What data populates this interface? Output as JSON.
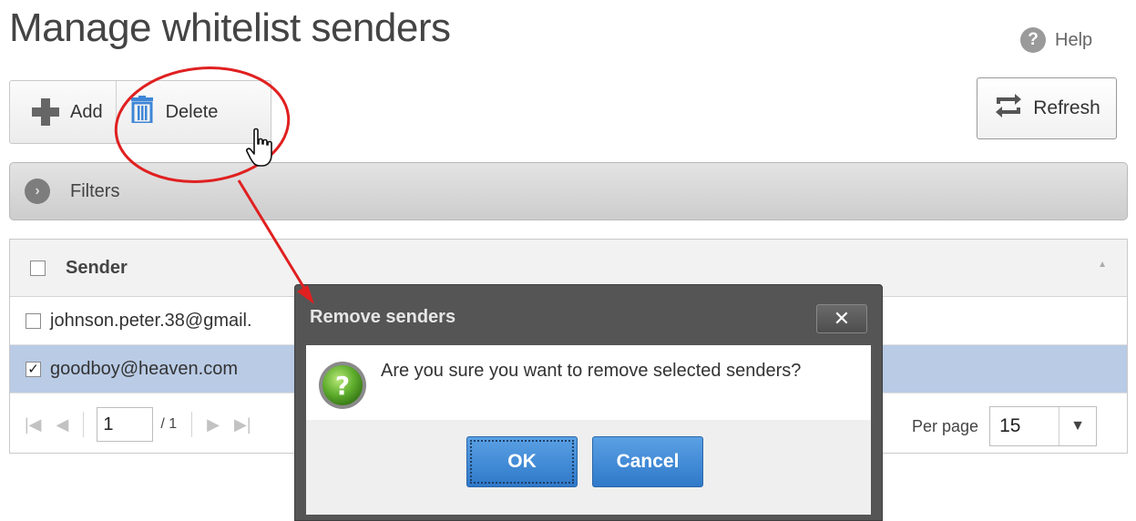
{
  "page": {
    "title": "Manage whitelist senders",
    "help_label": "Help"
  },
  "toolbar": {
    "add_label": "Add",
    "delete_label": "Delete",
    "refresh_label": "Refresh"
  },
  "filters": {
    "label": "Filters"
  },
  "table": {
    "columns": [
      "Sender"
    ],
    "rows": [
      {
        "sender": "johnson.peter.38@gmail.",
        "checked": false
      },
      {
        "sender": "goodboy@heaven.com",
        "checked": true
      }
    ]
  },
  "pager": {
    "current_page": "1",
    "total_pages": "/ 1",
    "per_page_label": "Per page",
    "per_page_value": "15"
  },
  "dialog": {
    "title": "Remove senders",
    "close_glyph": "✕",
    "message": "Are you sure you want to remove selected senders?",
    "ok_label": "OK",
    "cancel_label": "Cancel"
  },
  "colors": {
    "accent_blue": "#3f86d6",
    "selected_row": "#b9cbe5",
    "annotation_red": "#e02020"
  },
  "icons": [
    "help-icon",
    "plus-icon",
    "trash-icon",
    "refresh-icon",
    "chevron-right-icon",
    "sort-up-icon",
    "first-page-icon",
    "prev-page-icon",
    "next-page-icon",
    "last-page-icon",
    "chevron-down-icon",
    "close-icon",
    "question-icon",
    "hand-cursor-icon"
  ]
}
